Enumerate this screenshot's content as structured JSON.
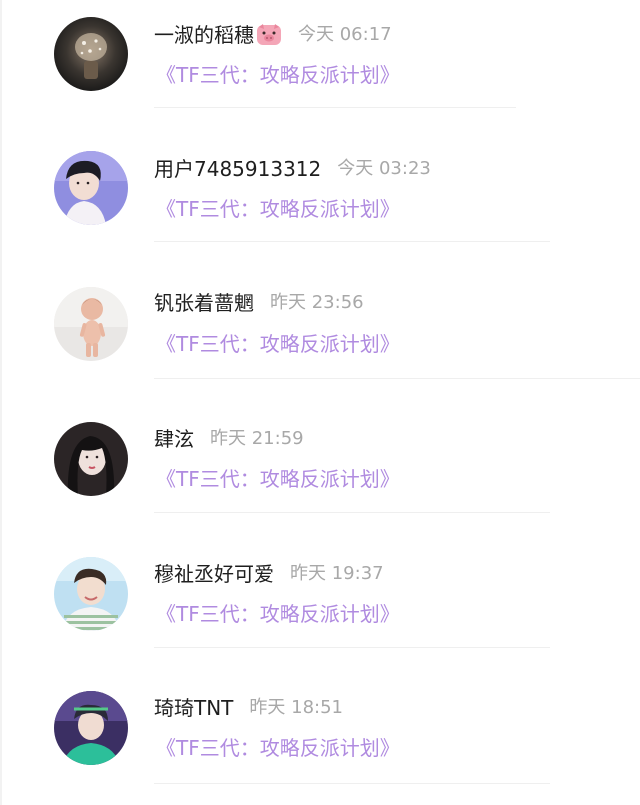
{
  "comments": [
    {
      "username": "一淑的稻穗",
      "time": "今天 06:17",
      "link": "《TF三代：攻略反派计划》",
      "avatar": "sparkle-photo-avatar",
      "emoji": "pig-face-icon"
    },
    {
      "username": "用户7485913312",
      "time": "今天 03:23",
      "link": "《TF三代：攻略反派计划》",
      "avatar": "boy-portrait-avatar"
    },
    {
      "username": "钒张着蔷魍",
      "time": "昨天 23:56",
      "link": "《TF三代：攻略反派计划》",
      "avatar": "doll-figure-avatar"
    },
    {
      "username": "肆泫",
      "time": "昨天 21:59",
      "link": "《TF三代：攻略反派计划》",
      "avatar": "girl-portrait-avatar"
    },
    {
      "username": "穆祉丞好可爱",
      "time": "昨天 19:37",
      "link": "《TF三代：攻略反派计划》",
      "avatar": "striped-shirt-boy-avatar"
    },
    {
      "username": "琦琦TNT",
      "time": "昨天 18:51",
      "link": "《TF三代：攻略反派计划》",
      "avatar": "stage-boy-avatar"
    }
  ],
  "colors": {
    "link": "#b08be0",
    "username": "#1e1e1e",
    "time": "#a8a8a8",
    "divider": "#efefef"
  }
}
